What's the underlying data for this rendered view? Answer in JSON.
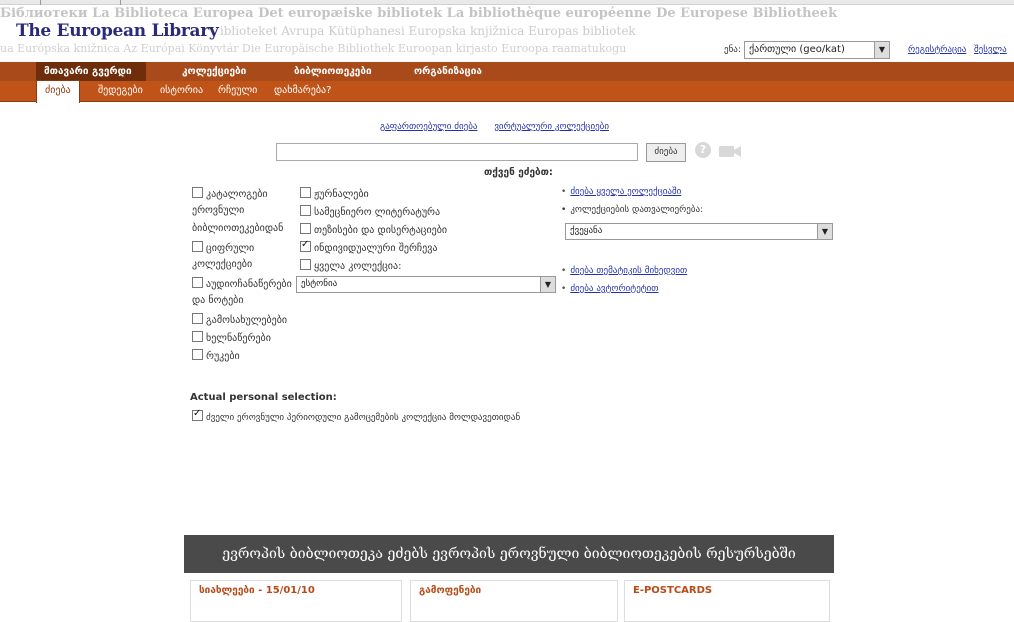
{
  "header": {
    "logo": "The European Library",
    "bg_line1": "Біблиотеки La Biblioteca Europea  Det europæiske bibliotek  La bibliothèque européenne  De Europese Bibliotheek",
    "bg_line2": "Det europeiska biblioteket  Avrupa Kütüphanesi  Europska knjižnica  Europas bibliotek",
    "bg_line3": "ua  Európska knižnica  Az Európai Könyvtár  Die Europäische Bibliothek  Euroopan kirjasto  Euroopa raamatukogu",
    "lang_label": "ენა:",
    "lang_value": "ქართული (geo/kat)",
    "link1": "რეგისტრაცია",
    "link2": "შესვლა"
  },
  "nav": {
    "main": [
      "მთავარი გვერდი",
      "კოლექციები",
      "ბიბლიოთეკები",
      "ორგანიზაცია"
    ],
    "sub": [
      "ძიება",
      "შედეგები",
      "ისტორია",
      "რჩეული",
      "დახმარება?"
    ]
  },
  "search": {
    "link_simple": "გაფართოებული ძიება",
    "link_advanced": "ვირტუალური კოლექციები",
    "button": "ძიება",
    "search_in": "თქვენ ეძებთ:"
  },
  "col1": {
    "cb1": "კატალოგები",
    "l1": "ეროვნული",
    "l2": "ბიბლიოთეკებიდან",
    "cb2": "ციფრული",
    "l3": "კოლექციები",
    "cb3": "აუდიოჩანაწერები",
    "l4": "და ნოტები",
    "cb4": "გამოსახულებები",
    "cb5": "ხელნაწერები",
    "cb6": "რუკები"
  },
  "col2": {
    "cb1": "ჟურნალები",
    "cb2": "სამეცნიერო ლიტერატურა",
    "cb3": "თეზისები და დისერტაციები",
    "cb4": "ინდივიდუალური შერჩევა",
    "cb5": "ყველა კოლექცია:",
    "select": "ესტონია"
  },
  "right": {
    "link1": "ძიება ყველა ეოლექციაში",
    "label": "კოლექციების დათვალიერება:",
    "select": "ქვეყანა",
    "link2": "ძიება თემატიკის მიხედვით",
    "link3": "ძიება ავტორიტეტით"
  },
  "actual": {
    "title": "Actual personal selection:",
    "item": "ძველი ეროვნული პერიოდული გამოცემების კოლექცია მოლდავეთიდან"
  },
  "footer": {
    "banner": "ევროპის ბიბლიოთეკა ეძებს ევროპის ეროვნული ბიბლიოთეკების რესურსებში",
    "p1": "სიახლეები - 15/01/10",
    "p2": "გამოფენები",
    "p3": "E-POSTCARDS"
  },
  "colors": {
    "nav_main": "#a84a1a",
    "nav_sub": "#c05418",
    "link": "#2233aa",
    "banner": "#4a4a4a"
  }
}
